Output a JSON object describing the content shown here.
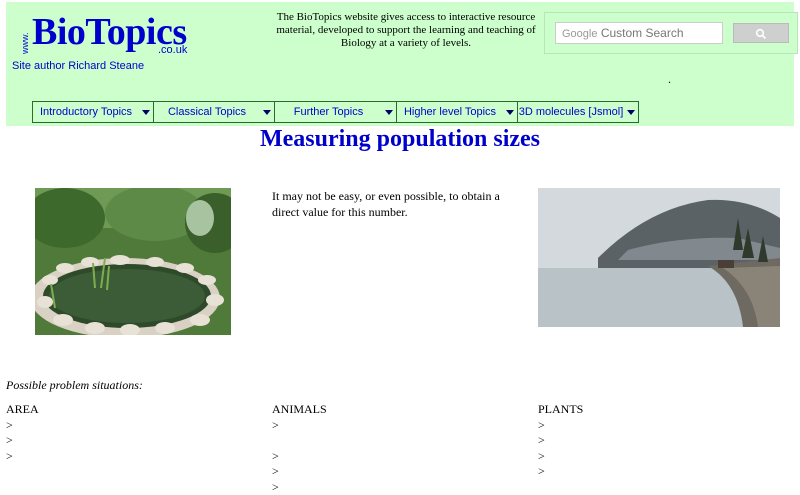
{
  "header": {
    "logo": {
      "www": "www.",
      "bio": "BioTopics",
      "couk": ".co.uk"
    },
    "author": "Site author Richard Steane",
    "tagline": "The BioTopics website gives access to interactive resource material, developed to support the learning and teaching of Biology at a variety of levels.",
    "search": {
      "placeholder": "Custom Search",
      "google_label": "Google",
      "button_icon": "search-icon"
    },
    "dot": "."
  },
  "nav": {
    "items": [
      {
        "label": "Introductory Topics"
      },
      {
        "label": "Classical Topics"
      },
      {
        "label": "Further Topics"
      },
      {
        "label": "Higher level Topics"
      },
      {
        "label": "3D molecules [Jsmol]"
      }
    ]
  },
  "main": {
    "title": "Measuring population sizes",
    "intro": "It may not be easy, or even possible, to obtain a direct value for this number.",
    "problem_label": "Possible problem situations:",
    "columns": [
      {
        "heading": "AREA",
        "rows": [
          ">",
          ">",
          ">"
        ]
      },
      {
        "heading": "ANIMALS",
        "rows": [
          ">",
          "",
          ">",
          ">",
          ">"
        ]
      },
      {
        "heading": "PLANTS",
        "rows": [
          ">",
          ">",
          ">",
          ">"
        ]
      }
    ]
  }
}
